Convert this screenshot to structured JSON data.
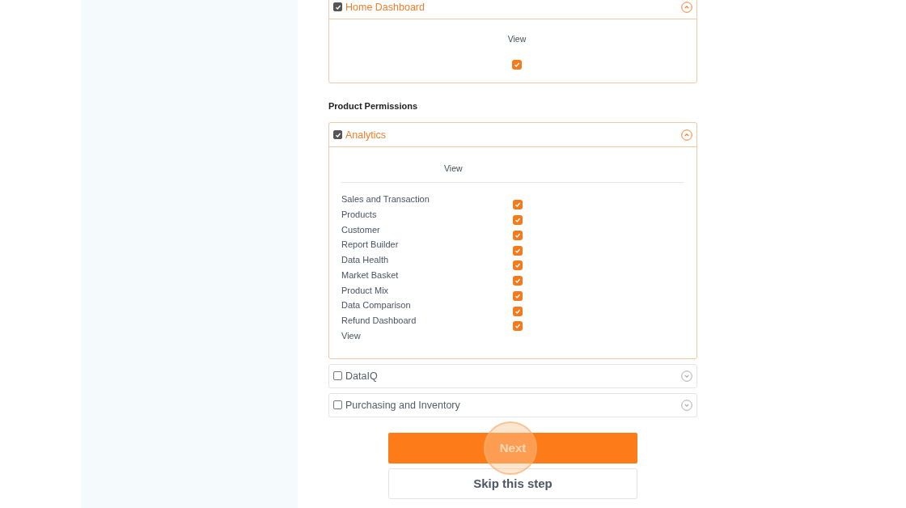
{
  "home_section": {
    "title": "Home Dashboard",
    "checked": true,
    "expanded": true,
    "column": "View",
    "view_checked": true
  },
  "product_permissions": {
    "heading": "Product Permissions",
    "sections": [
      {
        "title": "Analytics",
        "checked": true,
        "expanded": true,
        "column": "View",
        "rows": [
          {
            "label": "Sales and Transaction",
            "checked": true
          },
          {
            "label": "Products",
            "checked": true
          },
          {
            "label": "Customer",
            "checked": true
          },
          {
            "label": "Report Builder",
            "checked": true
          },
          {
            "label": "Data Health",
            "checked": true
          },
          {
            "label": "Market Basket",
            "checked": true
          },
          {
            "label": "Product Mix",
            "checked": true
          },
          {
            "label": "Data Comparison",
            "checked": true
          },
          {
            "label": "Refund Dashboard",
            "checked": true
          }
        ],
        "footer_label": "View"
      },
      {
        "title": "DataIQ",
        "checked": false,
        "expanded": false
      },
      {
        "title": "Purchasing and Inventory",
        "checked": false,
        "expanded": false
      }
    ]
  },
  "next_button": "Next",
  "skip_button": "Skip this step"
}
